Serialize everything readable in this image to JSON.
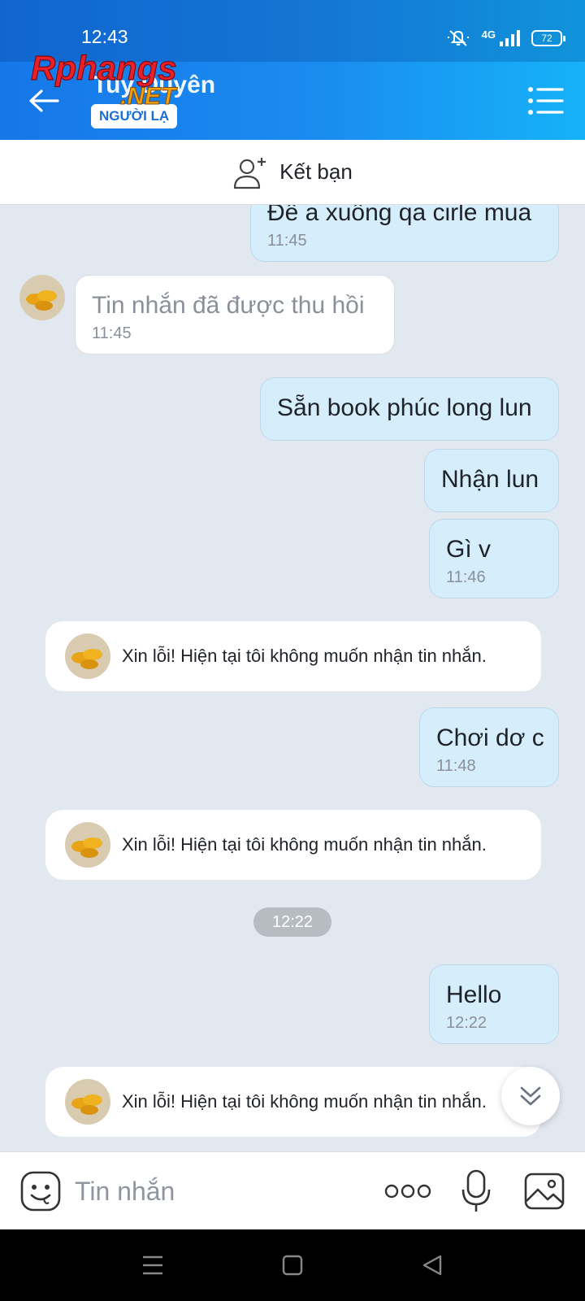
{
  "status_bar": {
    "time": "12:43",
    "network": "4G",
    "battery": "72"
  },
  "header": {
    "contact_name": "Tuy Duyên",
    "badge": "NGƯỜI LẠ",
    "watermark_text": "Rphangs.NET"
  },
  "add_friend": {
    "label": "Kết bạn"
  },
  "messages": [
    {
      "text": "Để a xuống qa cirle mua",
      "time": "11:45"
    },
    {
      "text": "Tin nhắn đã được thu hồi",
      "time": "11:45"
    },
    {
      "text": "Sẵn book phúc long lun"
    },
    {
      "text": "Nhận lun"
    },
    {
      "text": "Gì v",
      "time": "11:46"
    },
    {
      "text": "Xin lỗi! Hiện tại tôi không muốn nhận tin nhắn."
    },
    {
      "text": "Chơi dơ c",
      "time": "11:48"
    },
    {
      "text": "Xin lỗi! Hiện tại tôi không muốn nhận tin nhắn."
    },
    {
      "text": "12:22"
    },
    {
      "text": "Hello",
      "time": "12:22"
    },
    {
      "text": "Xin lỗi! Hiện tại tôi không muốn nhận tin nhắn."
    }
  ],
  "input": {
    "placeholder": "Tin nhắn"
  },
  "colors": {
    "header_start": "#1677e8",
    "header_end": "#16b2f8",
    "my_bubble": "#d6eefc",
    "chat_bg": "#e2e8f0"
  }
}
